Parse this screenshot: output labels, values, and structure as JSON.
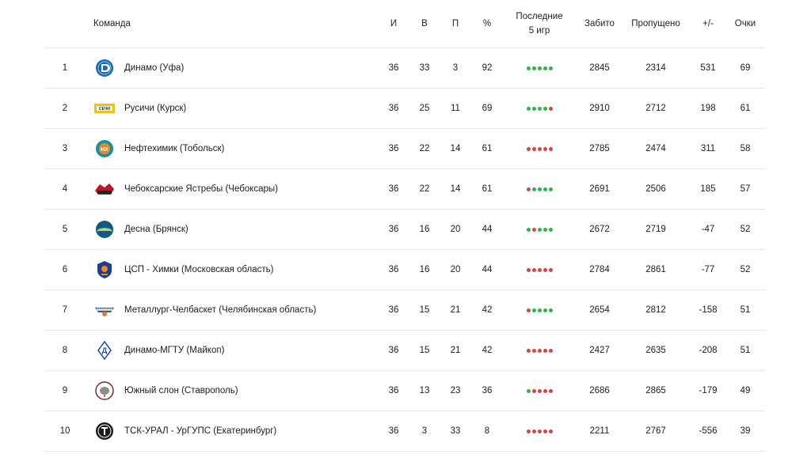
{
  "colors": {
    "win": "#2fb34a",
    "loss": "#d64545",
    "border": "#e6e6e6"
  },
  "headers": {
    "team": "Команда",
    "games": "И",
    "wins": "В",
    "losses": "П",
    "pct": "%",
    "last5_line1": "Последние",
    "last5_line2": "5 игр",
    "scored": "Забито",
    "allowed": "Пропущено",
    "diff": "+/-",
    "points": "Очки"
  },
  "rows": [
    {
      "rank": "1",
      "team": "Динамо (Уфа)",
      "logo": "dinamo-ufa-logo",
      "games": "36",
      "wins": "33",
      "losses": "3",
      "pct": "92",
      "form": [
        "W",
        "W",
        "W",
        "W",
        "W"
      ],
      "scored": "2845",
      "allowed": "2314",
      "diff": "531",
      "points": "69"
    },
    {
      "rank": "2",
      "team": "Русичи (Курск)",
      "logo": "rusichi-logo",
      "games": "36",
      "wins": "25",
      "losses": "11",
      "pct": "69",
      "form": [
        "W",
        "W",
        "W",
        "W",
        "L"
      ],
      "scored": "2910",
      "allowed": "2712",
      "diff": "198",
      "points": "61"
    },
    {
      "rank": "3",
      "team": "Нефтехимик (Тобольск)",
      "logo": "neftekhimik-logo",
      "games": "36",
      "wins": "22",
      "losses": "14",
      "pct": "61",
      "form": [
        "L",
        "L",
        "L",
        "L",
        "L"
      ],
      "scored": "2785",
      "allowed": "2474",
      "diff": "311",
      "points": "58"
    },
    {
      "rank": "4",
      "team": "Чебоксарские Ястребы (Чебоксары)",
      "logo": "yastreby-logo",
      "games": "36",
      "wins": "22",
      "losses": "14",
      "pct": "61",
      "form": [
        "L",
        "W",
        "W",
        "W",
        "W"
      ],
      "scored": "2691",
      "allowed": "2506",
      "diff": "185",
      "points": "57"
    },
    {
      "rank": "5",
      "team": "Десна (Брянск)",
      "logo": "desna-logo",
      "games": "36",
      "wins": "16",
      "losses": "20",
      "pct": "44",
      "form": [
        "W",
        "L",
        "W",
        "W",
        "W"
      ],
      "scored": "2672",
      "allowed": "2719",
      "diff": "-47",
      "points": "52"
    },
    {
      "rank": "6",
      "team": "ЦСП - Химки (Московская область)",
      "logo": "csp-khimki-logo",
      "games": "36",
      "wins": "16",
      "losses": "20",
      "pct": "44",
      "form": [
        "L",
        "L",
        "L",
        "L",
        "L"
      ],
      "scored": "2784",
      "allowed": "2861",
      "diff": "-77",
      "points": "52"
    },
    {
      "rank": "7",
      "team": "Металлург-Челбаскет (Челябинская область)",
      "logo": "metallurg-logo",
      "games": "36",
      "wins": "15",
      "losses": "21",
      "pct": "42",
      "form": [
        "L",
        "W",
        "W",
        "W",
        "W"
      ],
      "scored": "2654",
      "allowed": "2812",
      "diff": "-158",
      "points": "51"
    },
    {
      "rank": "8",
      "team": "Динамо-МГТУ (Майкоп)",
      "logo": "dinamo-mgtu-logo",
      "games": "36",
      "wins": "15",
      "losses": "21",
      "pct": "42",
      "form": [
        "L",
        "L",
        "L",
        "L",
        "L"
      ],
      "scored": "2427",
      "allowed": "2635",
      "diff": "-208",
      "points": "51"
    },
    {
      "rank": "9",
      "team": "Южный слон (Ставрополь)",
      "logo": "yuzhny-slon-logo",
      "games": "36",
      "wins": "13",
      "losses": "23",
      "pct": "36",
      "form": [
        "W",
        "L",
        "L",
        "L",
        "L"
      ],
      "scored": "2686",
      "allowed": "2865",
      "diff": "-179",
      "points": "49"
    },
    {
      "rank": "10",
      "team": "ТСК-УРАЛ - УрГУПС (Екатеринбург)",
      "logo": "tsk-ural-logo",
      "games": "36",
      "wins": "3",
      "losses": "33",
      "pct": "8",
      "form": [
        "L",
        "L",
        "L",
        "L",
        "L"
      ],
      "scored": "2211",
      "allowed": "2767",
      "diff": "-556",
      "points": "39"
    }
  ]
}
